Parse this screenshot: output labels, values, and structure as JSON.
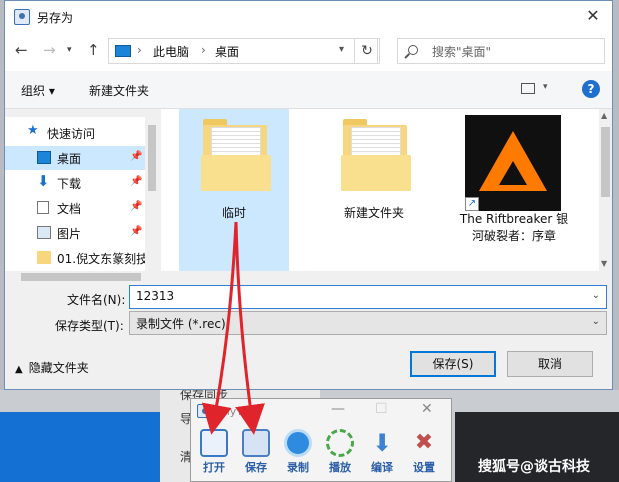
{
  "dialog": {
    "title": "另存为",
    "address": {
      "root": "此电脑",
      "current": "桌面"
    },
    "search_placeholder": "搜索\"桌面\"",
    "toolbar": {
      "organize": "组织 ▾",
      "new_folder": "新建文件夹"
    },
    "sidebar": [
      {
        "label": "快速访问",
        "icon": "star-icon"
      },
      {
        "label": "桌面",
        "icon": "desktop-icon",
        "selected": true,
        "pinned": true
      },
      {
        "label": "下载",
        "icon": "download-icon",
        "pinned": true
      },
      {
        "label": "文档",
        "icon": "document-icon",
        "pinned": true
      },
      {
        "label": "图片",
        "icon": "picture-icon",
        "pinned": true
      },
      {
        "label": "01.倪文东篆刻技",
        "icon": "folder-icon"
      }
    ],
    "files": [
      {
        "name": "临时",
        "type": "folder",
        "selected": true
      },
      {
        "name": "新建文件夹",
        "type": "folder"
      },
      {
        "name": "The Riftbreaker 银河破裂者：序章",
        "type": "shortcut"
      }
    ],
    "filename_label": "文件名(N):",
    "filename_value": "12313",
    "filetype_label": "保存类型(T):",
    "filetype_value": "录制文件 (*.rec)",
    "hide_folders": "隐藏文件夹",
    "save_button": "保存(S)",
    "cancel_button": "取消"
  },
  "background": {
    "panel_items": [
      "保存同步",
      "导",
      "清"
    ]
  },
  "mini_app": {
    "title": "myTe",
    "tools": [
      {
        "label": "打开",
        "icon": "open-icon",
        "color": "#3a78c8"
      },
      {
        "label": "保存",
        "icon": "save-icon",
        "color": "#4a7fc1"
      },
      {
        "label": "录制",
        "icon": "record-icon",
        "color": "#2f8be0"
      },
      {
        "label": "播放",
        "icon": "play-icon",
        "color": "#4aa84a"
      },
      {
        "label": "编译",
        "icon": "compile-icon",
        "color": "#3a82d6"
      },
      {
        "label": "设置",
        "icon": "settings-icon",
        "color": "#c0504d"
      }
    ]
  },
  "watermark": "搜狐号@谈古科技",
  "colors": {
    "accent": "#0078d7",
    "selection": "#cce8ff",
    "arrow": "#e0242c"
  }
}
